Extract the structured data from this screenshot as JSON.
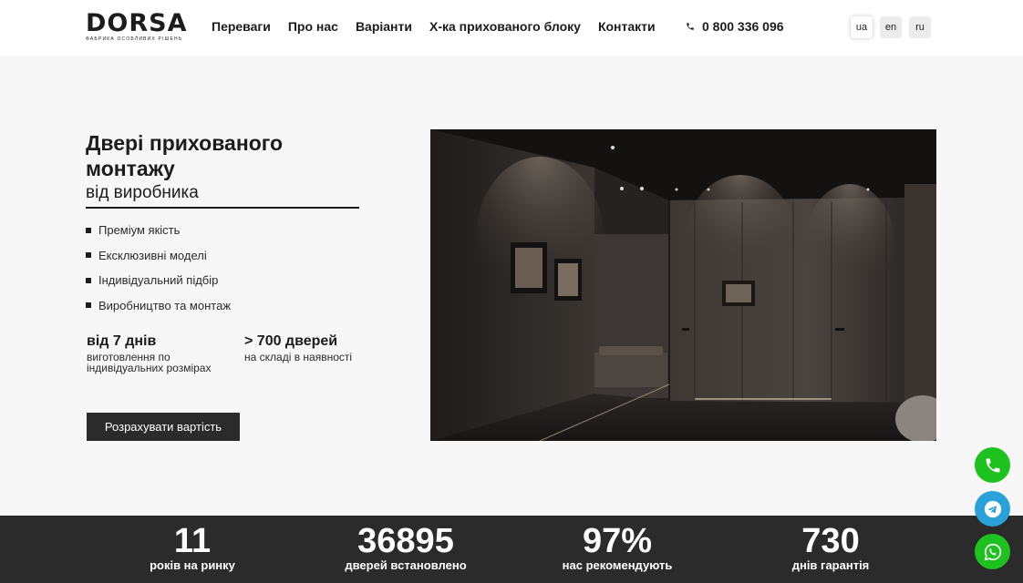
{
  "header": {
    "logo_word": "DORSA",
    "logo_tagline": "ФАБРИКА ОСОБЛИВИХ РІШЕНЬ",
    "nav": [
      "Переваги",
      "Про нас",
      "Варіанти",
      "Х-ка прихованого блоку",
      "Контакти"
    ],
    "phone": "0 800 336 096",
    "languages": [
      "ua",
      "en",
      "ru"
    ],
    "active_language": "ua"
  },
  "hero": {
    "title": "Двері прихованого монтажу",
    "subtitle": "від виробника",
    "features": [
      "Преміум якість",
      "Ексклюзивні моделі",
      "Індивідуальний підбір",
      "Виробництво та монтаж"
    ],
    "stat1": {
      "value": "від 7 днів",
      "desc": "виготовлення по індивідуальних розмірах"
    },
    "stat2": {
      "value": "> 700 дверей",
      "desc": "на складі в наявності"
    },
    "cta_label": "Розрахувати вартість"
  },
  "stats": [
    {
      "value": "11",
      "label": "років на ринку"
    },
    {
      "value": "36895",
      "label": "дверей встановлено"
    },
    {
      "value": "97%",
      "label": "нас рекомендують"
    },
    {
      "value": "730",
      "label": "днів гарантія"
    }
  ],
  "colors": {
    "accent_dark": "#2b2b2b",
    "whatsapp_green": "#1ec21e",
    "telegram_blue": "#2aa1d9",
    "page_bg": "#f7f7f7"
  },
  "floating": [
    "phone-icon",
    "telegram-icon",
    "whatsapp-icon"
  ]
}
